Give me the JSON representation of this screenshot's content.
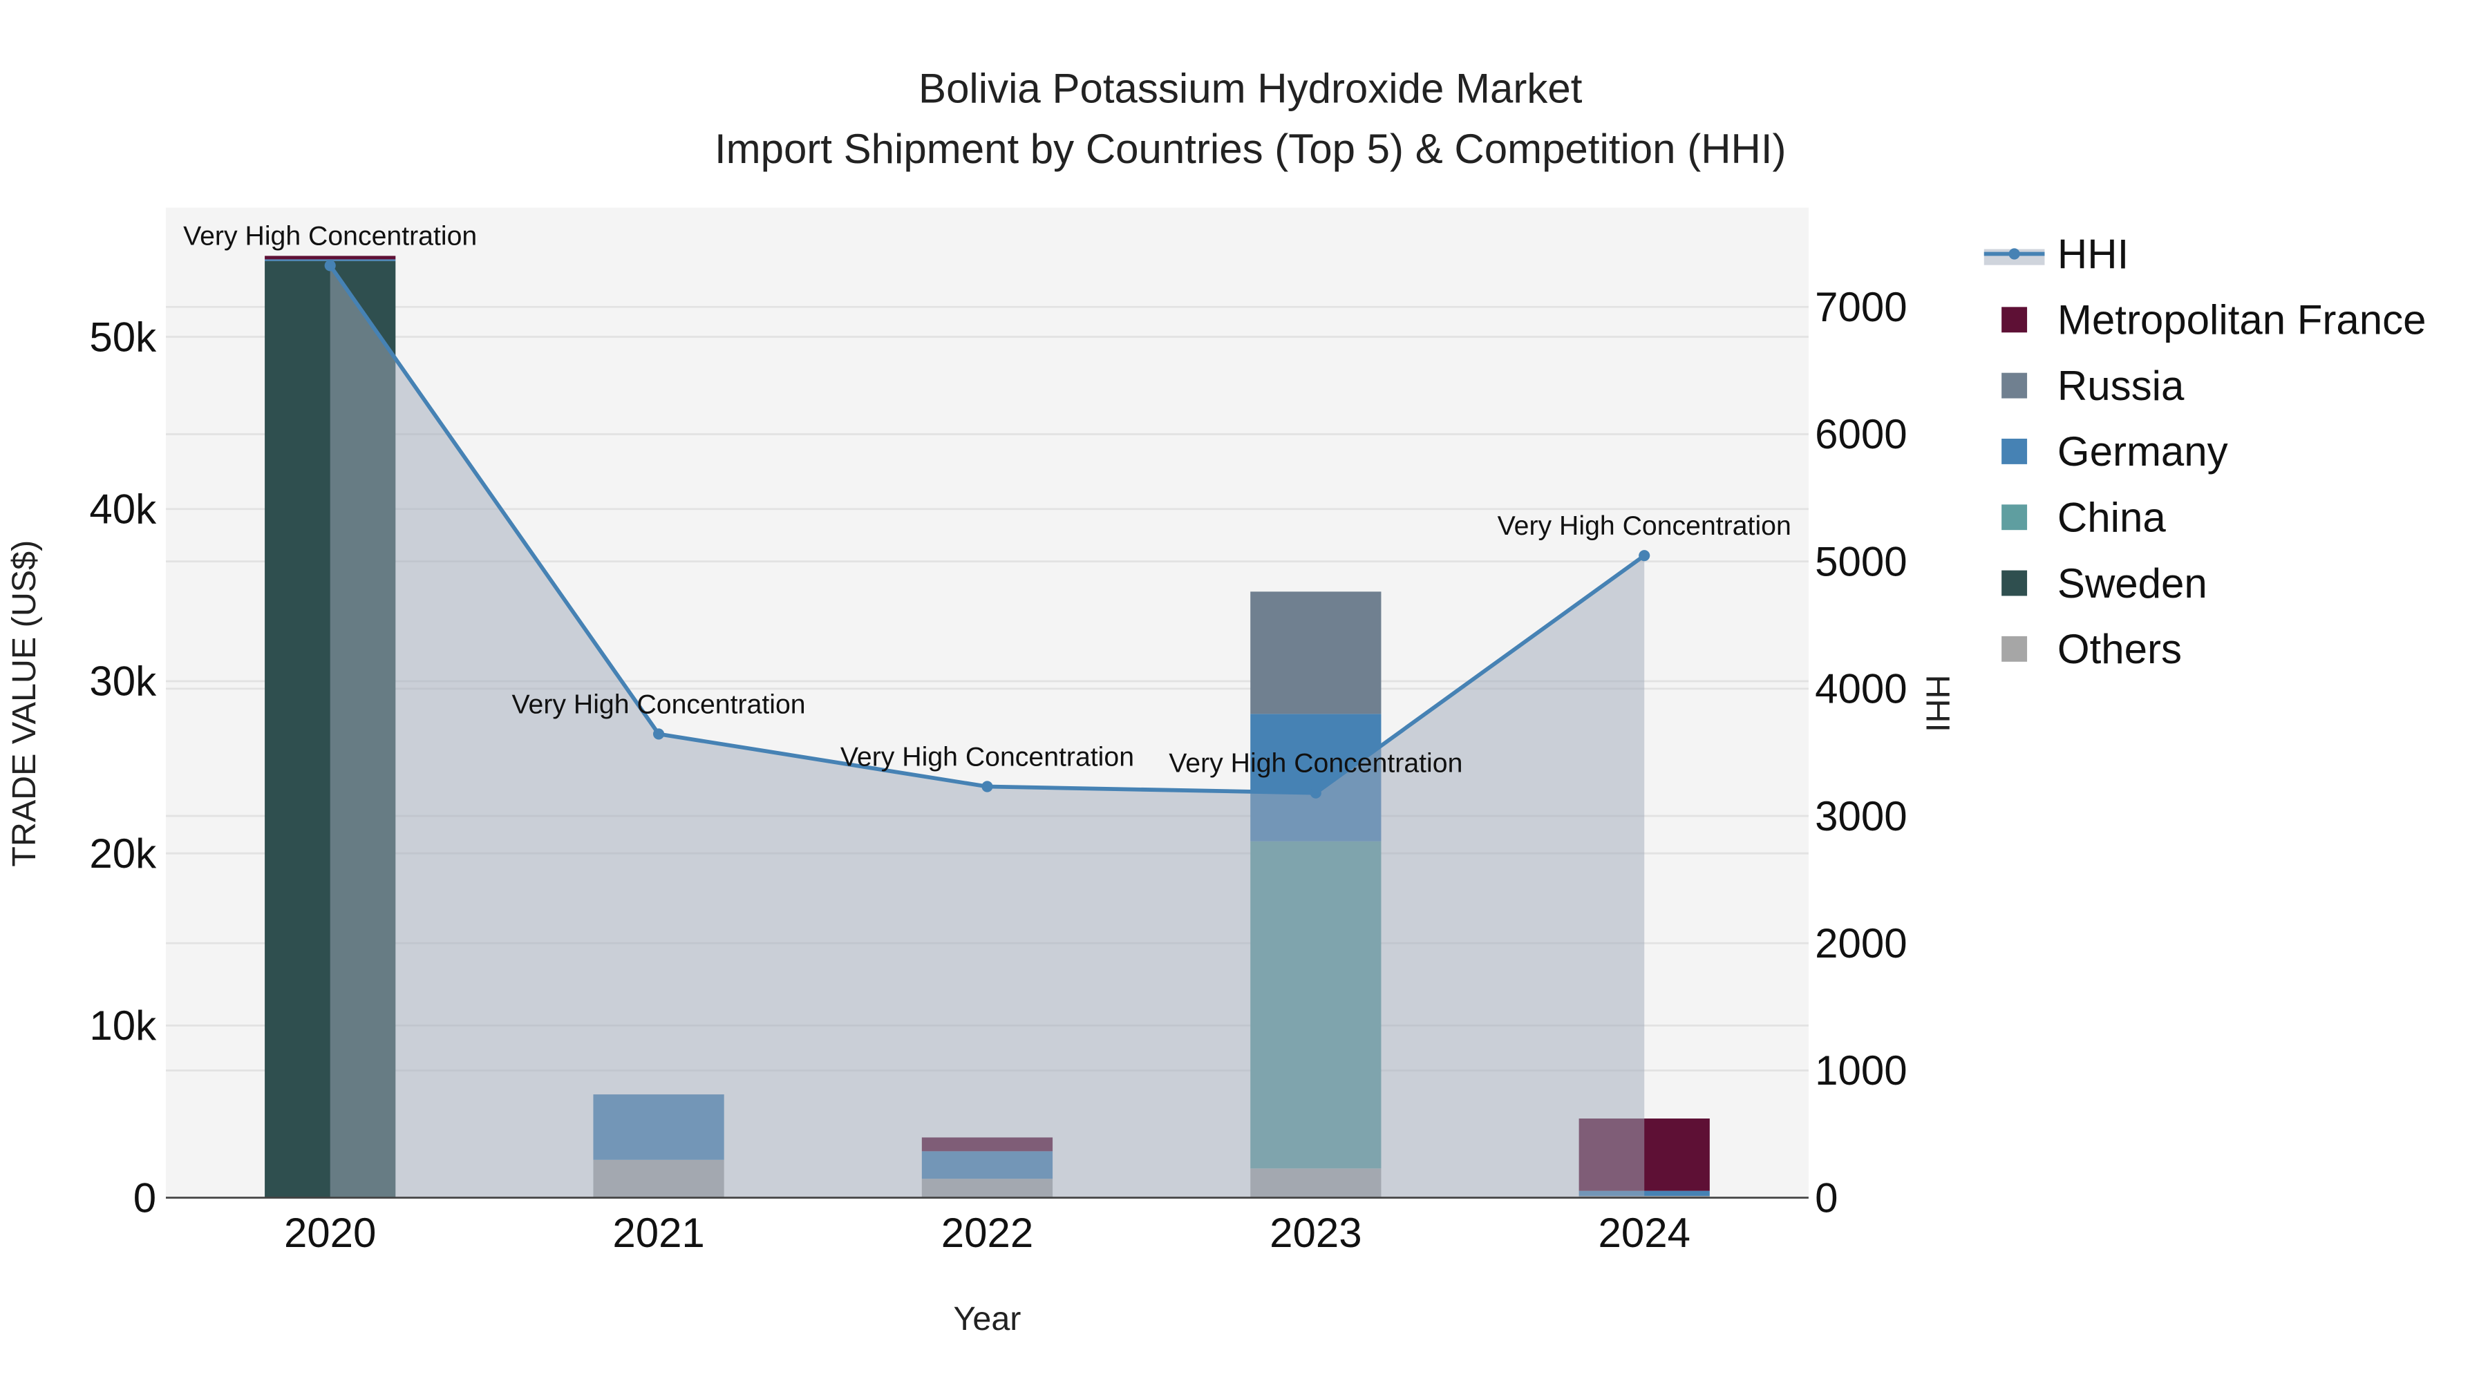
{
  "chart_data": {
    "type": "bar",
    "title": "Bolivia Potassium Hydroxide Market",
    "subtitle": "Import Shipment by Countries (Top 5) & Competition (HHI)",
    "xlabel": "Year",
    "ylabel": "TRADE VALUE (US$)",
    "y2label": "HHI",
    "categories": [
      "2020",
      "2021",
      "2022",
      "2023",
      "2024"
    ],
    "ylim": [
      0,
      57500
    ],
    "y2lim": [
      0,
      7780
    ],
    "yticks": [
      0,
      10000,
      20000,
      30000,
      40000,
      50000
    ],
    "ytick_labels": [
      "0",
      "10k",
      "20k",
      "30k",
      "40k",
      "50k"
    ],
    "y2ticks": [
      0,
      1000,
      2000,
      3000,
      4000,
      5000,
      6000,
      7000
    ],
    "y2tick_labels": [
      "0",
      "1000",
      "2000",
      "3000",
      "4000",
      "5000",
      "6000",
      "7000"
    ],
    "stacked": true,
    "series": [
      {
        "name": "Others",
        "color": "#a6a6a6",
        "values": [
          0,
          2200,
          1100,
          1700,
          100
        ]
      },
      {
        "name": "Sweden",
        "color": "#2f4f4f",
        "values": [
          54400,
          0,
          0,
          0,
          0
        ]
      },
      {
        "name": "China",
        "color": "#5f9ea0",
        "values": [
          0,
          0,
          0,
          19000,
          0
        ]
      },
      {
        "name": "Germany",
        "color": "#4682b4",
        "values": [
          100,
          3800,
          1600,
          7400,
          300
        ]
      },
      {
        "name": "Russia",
        "color": "#708090",
        "values": [
          0,
          0,
          0,
          7100,
          0
        ]
      },
      {
        "name": "Metropolitan France",
        "color": "#5e1035",
        "values": [
          200,
          0,
          800,
          0,
          4200
        ]
      }
    ],
    "line": {
      "name": "HHI",
      "color": "#4682b4",
      "values": [
        7325,
        3644,
        3231,
        3181,
        5046
      ],
      "annotations": [
        "Very High Concentration",
        "Very High Concentration",
        "Very High Concentration",
        "Very High Concentration",
        "Very High Concentration"
      ]
    },
    "legend_order": [
      "HHI",
      "Metropolitan France",
      "Russia",
      "Germany",
      "China",
      "Sweden",
      "Others"
    ],
    "legend_position": "right",
    "grid": true
  }
}
